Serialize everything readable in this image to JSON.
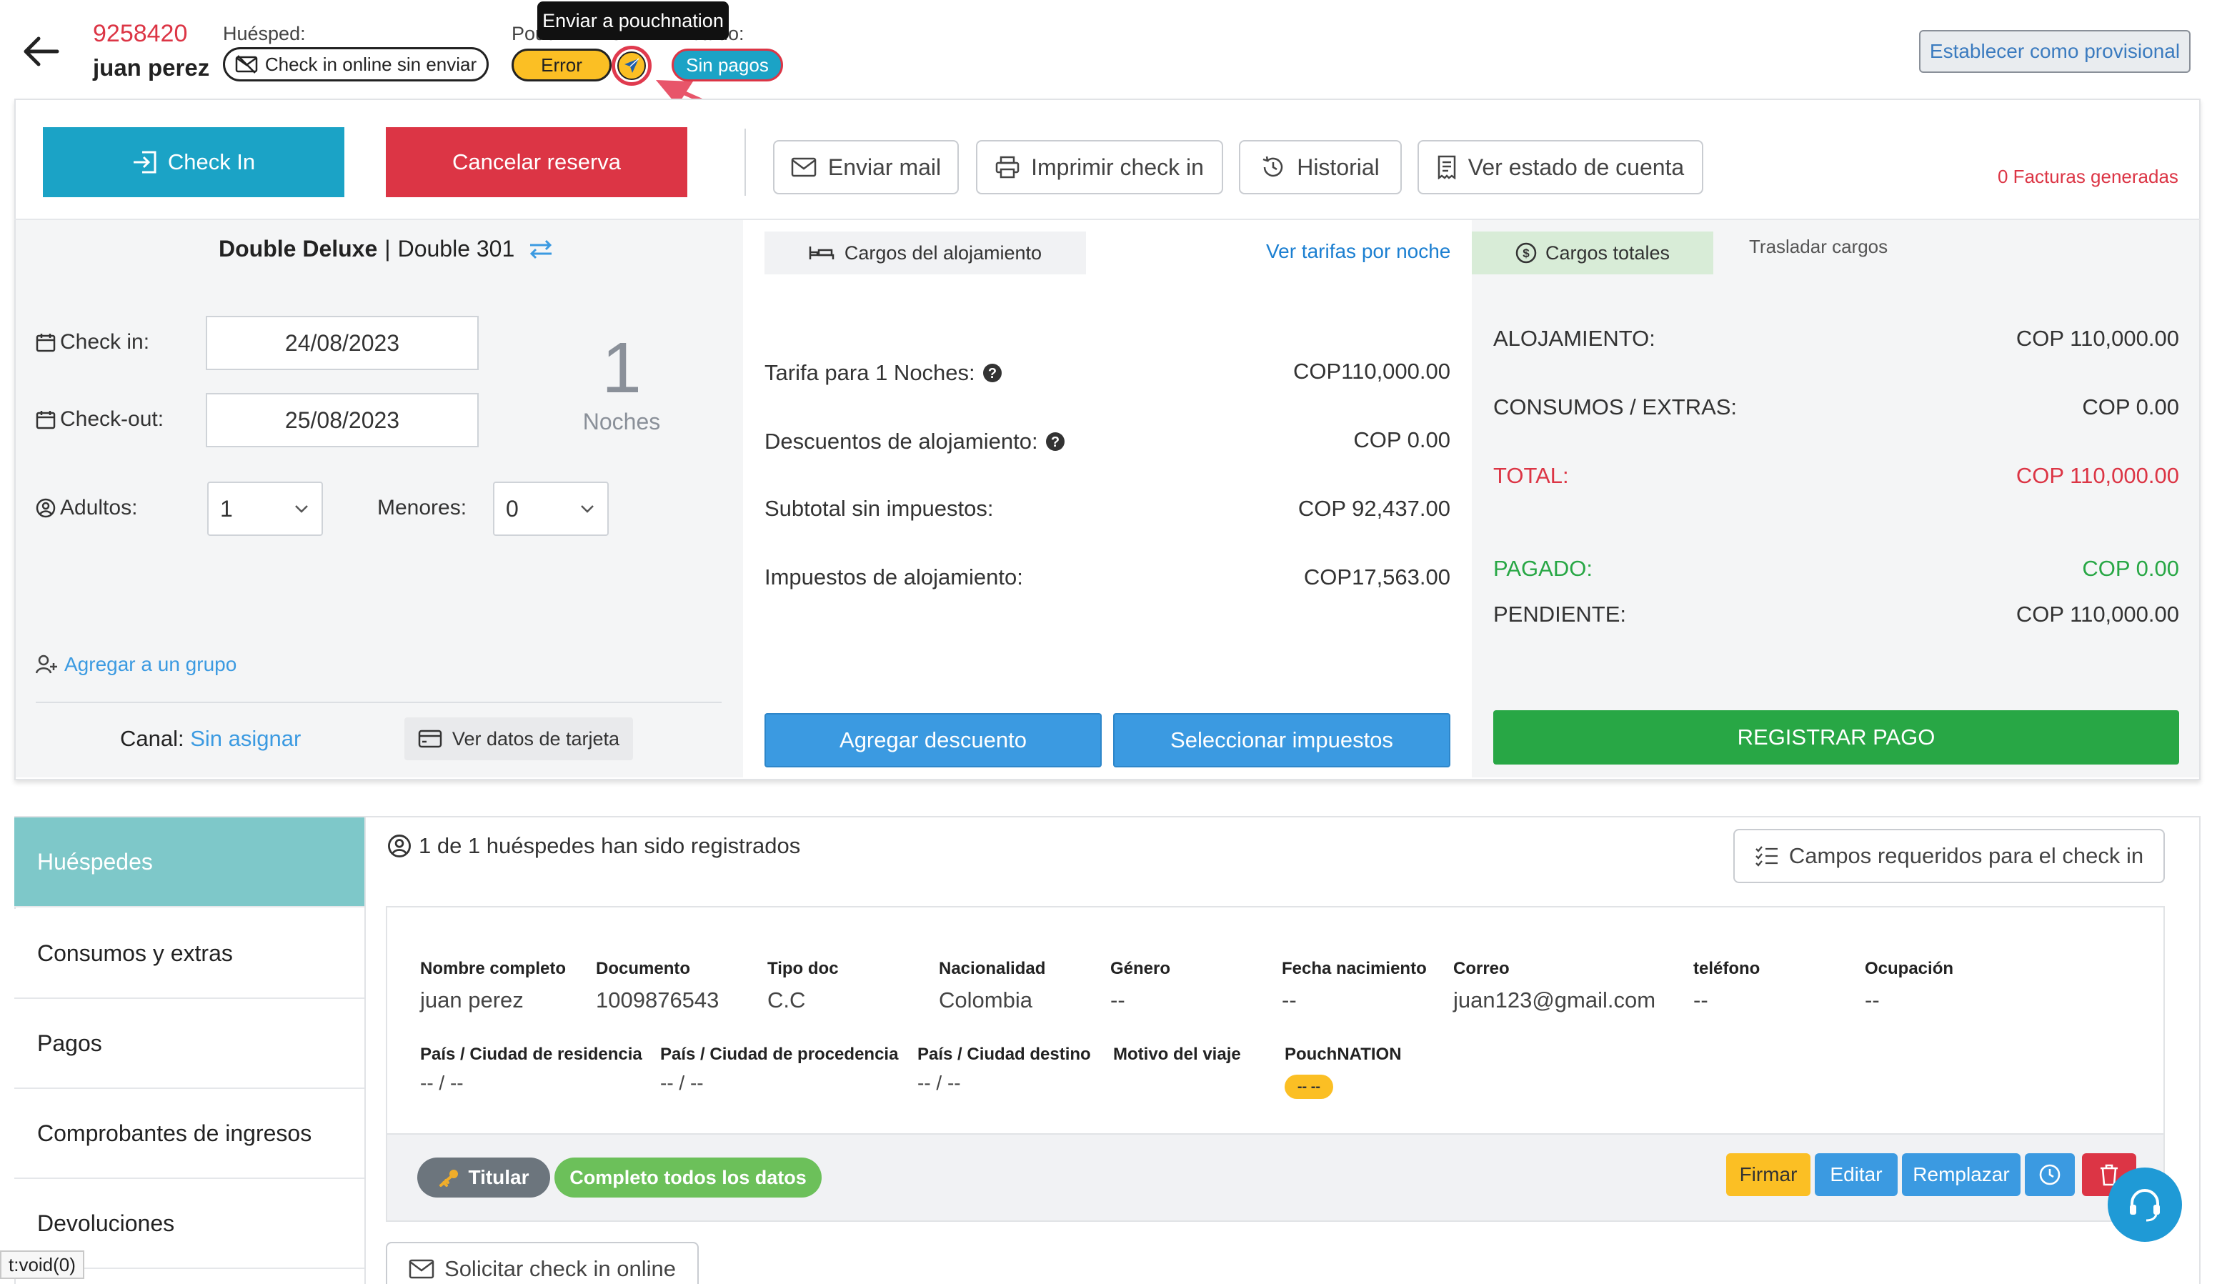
{
  "header": {
    "reservation_number": "9258420",
    "guest_name": "juan perez",
    "guest_label": "Huésped:",
    "checkin_online_status": "Check in online sin enviar",
    "pouch_label": "PouchNATION",
    "pouch_status": "Error",
    "status_label": "Estado:",
    "payment_status": "Sin pagos",
    "tooltip": "Enviar a pouchnation",
    "provisional_button": "Establecer como provisional"
  },
  "actions": {
    "checkin": "Check In",
    "cancel": "Cancelar reserva",
    "send_mail": "Enviar mail",
    "print_checkin": "Imprimir check in",
    "history": "Historial",
    "account_status": "Ver estado de cuenta",
    "invoices": "0 Facturas generadas"
  },
  "room": {
    "type": "Double Deluxe",
    "separator": "|",
    "name": "Double 301",
    "checkin_label": "Check in:",
    "checkin_value": "24/08/2023",
    "checkout_label": "Check-out:",
    "checkout_value": "25/08/2023",
    "nights_count": "1",
    "nights_label": "Noches",
    "adults_label": "Adultos:",
    "adults_value": "1",
    "minors_label": "Menores:",
    "minors_value": "0",
    "add_group": "Agregar a un grupo",
    "channel_label": "Canal:",
    "channel_value": "Sin asignar",
    "card_button": "Ver datos de tarjeta"
  },
  "charges": {
    "tab_lodging": "Cargos del alojamiento",
    "rates_link": "Ver tarifas por noche",
    "rows": [
      {
        "label": "Tarifa para 1 Noches:",
        "value": "COP110,000.00"
      },
      {
        "label": "Descuentos de alojamiento:",
        "value": "COP 0.00"
      },
      {
        "label": "Subtotal sin impuestos:",
        "value": "COP 92,437.00"
      },
      {
        "label": "Impuestos de alojamiento:",
        "value": "COP17,563.00"
      }
    ],
    "add_discount": "Agregar descuento",
    "select_taxes": "Seleccionar impuestos"
  },
  "totals": {
    "tab_total": "Cargos totales",
    "tab_transfer": "Trasladar cargos",
    "lodging_label": "ALOJAMIENTO:",
    "lodging_value": "COP 110,000.00",
    "extras_label": "CONSUMOS / EXTRAS:",
    "extras_value": "COP 0.00",
    "total_label": "TOTAL:",
    "total_value": "COP 110,000.00",
    "paid_label": "PAGADO:",
    "paid_value": "COP 0.00",
    "pending_label": "PENDIENTE:",
    "pending_value": "COP 110,000.00",
    "register_payment": "REGISTRAR PAGO"
  },
  "sidebar": {
    "items": [
      "Huéspedes",
      "Consumos y extras",
      "Pagos",
      "Comprobantes de ingresos",
      "Devoluciones"
    ]
  },
  "guests": {
    "summary": "1 de 1 huéspedes han sido registrados",
    "required_fields_button": "Campos requeridos para el check in",
    "row1_headers": [
      "Nombre completo",
      "Documento",
      "Tipo doc",
      "Nacionalidad",
      "Género",
      "Fecha nacimiento",
      "Correo",
      "teléfono",
      "Ocupación"
    ],
    "row1_values": [
      "juan perez",
      "1009876543",
      "C.C",
      "Colombia",
      "--",
      "--",
      "juan123@gmail.com",
      "--",
      "--"
    ],
    "row2_headers": [
      "País / Ciudad de residencia",
      "País / Ciudad de procedencia",
      "País / Ciudad destino",
      "Motivo del viaje",
      "PouchNATION"
    ],
    "row2_values": [
      "-- / --",
      "-- / --",
      "-- / --",
      "",
      "-- --"
    ],
    "holder_badge": "Titular",
    "complete_badge": "Completo todos los datos",
    "sign": "Firmar",
    "edit": "Editar",
    "replace": "Remplazar",
    "request_online": "Solicitar check in online"
  },
  "statusbar": {
    "text": "t:void(0)"
  },
  "colors": {
    "teal": "#1ba3c6",
    "red": "#dc3545",
    "green": "#28a745",
    "blue_btn": "#3b9ae1",
    "yellow": "#fbbf24",
    "sidebar_active": "#7ec8c9"
  }
}
